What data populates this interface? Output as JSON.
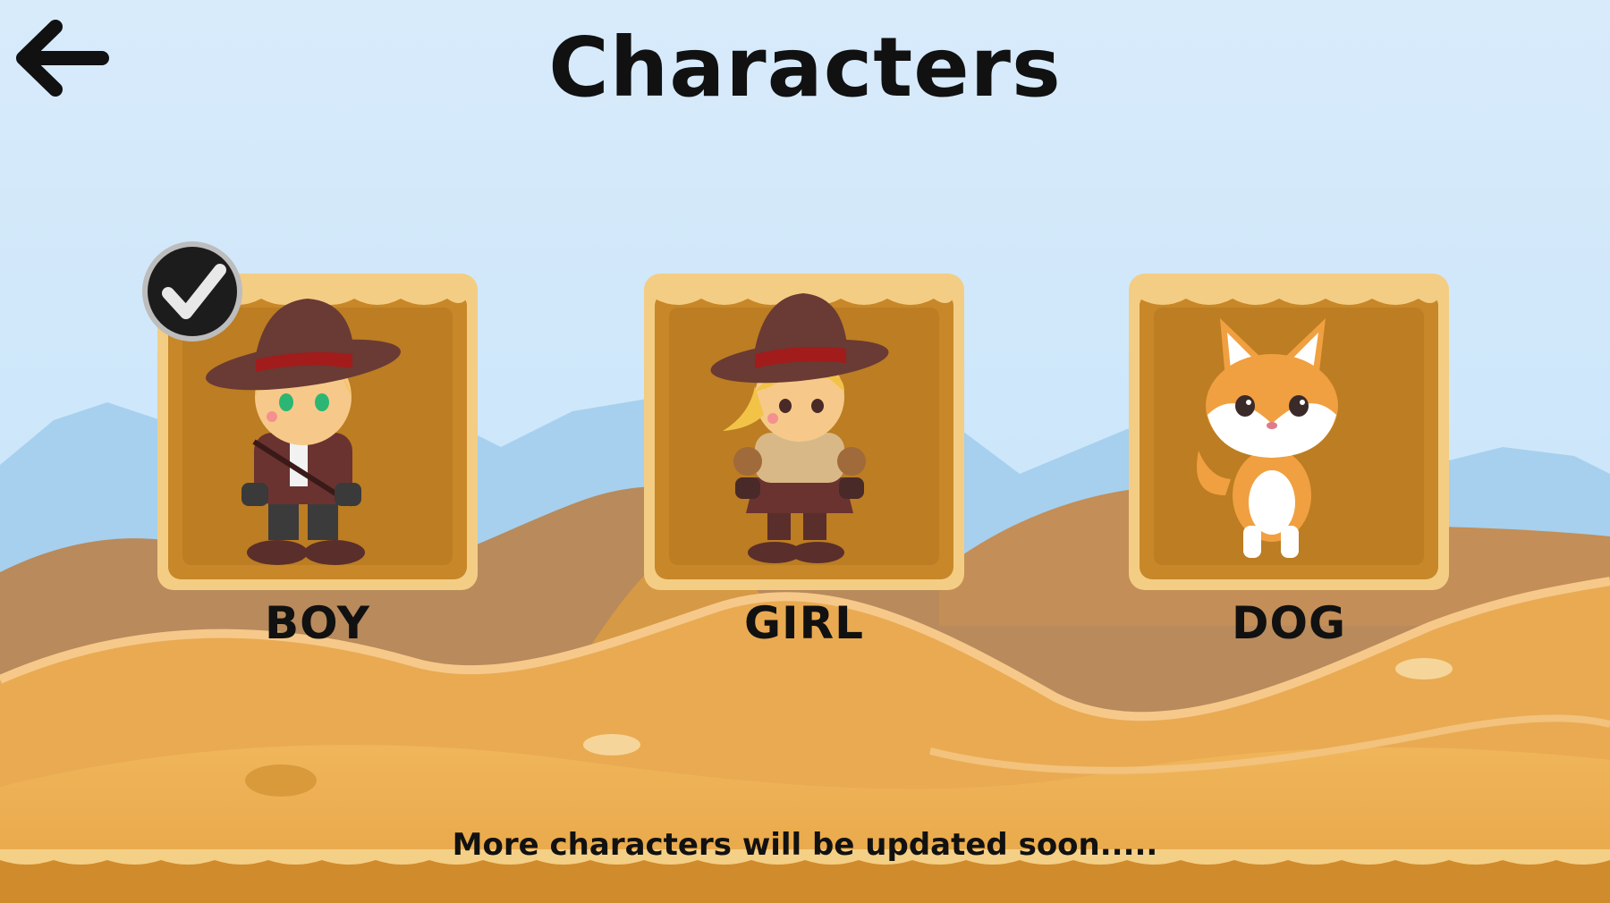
{
  "screen": {
    "title": "Characters",
    "back_icon": "arrow-left-icon",
    "footer_note": "More characters will be updated soon....."
  },
  "characters": [
    {
      "label": "BOY",
      "selected": true
    },
    {
      "label": "GIRL",
      "selected": false
    },
    {
      "label": "DOG",
      "selected": false
    }
  ],
  "colors": {
    "sky_top": "#d6e9fa",
    "sky_bottom": "#bfe0f7",
    "far_hills": "#a9d3ee",
    "mid_dunes": "#b58960",
    "sand_light": "#f0b860",
    "sand_main": "#e8a64a",
    "card_border": "#f4cf86",
    "card_inner": "#c98a2a",
    "hat_brown": "#6a3a34",
    "hat_band": "#a21c1c"
  }
}
